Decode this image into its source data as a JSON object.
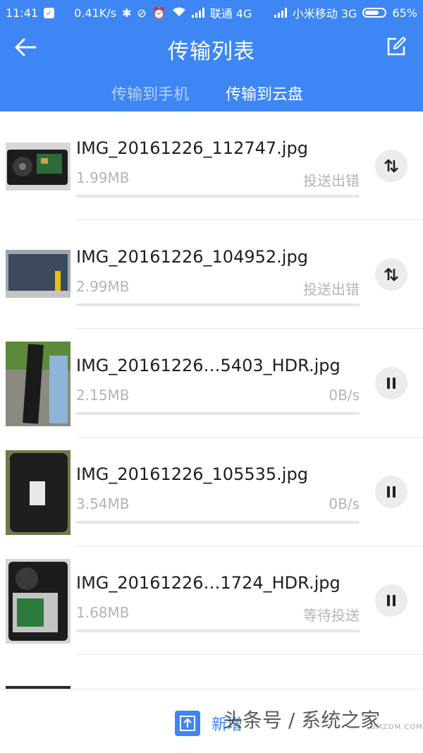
{
  "status_bar": {
    "time": "11:41",
    "net_speed": "0.41K/s",
    "carrier1": "联通 4G",
    "carrier2": "小米移动 3G",
    "battery": "65%"
  },
  "header": {
    "title": "传输列表",
    "tabs": [
      {
        "label": "传输到手机",
        "active": false
      },
      {
        "label": "传输到云盘",
        "active": true
      }
    ]
  },
  "transfers": [
    {
      "name": "IMG_20161226_112747.jpg",
      "size": "1.99MB",
      "status": "投送出错",
      "action": "retry-icon",
      "progress": 0
    },
    {
      "name": "IMG_20161226_104952.jpg",
      "size": "2.99MB",
      "status": "投送出错",
      "action": "retry-icon",
      "progress": 0
    },
    {
      "name": "IMG_20161226…5403_HDR.jpg",
      "size": "2.15MB",
      "status": "0B/s",
      "action": "pause-icon",
      "progress": 0
    },
    {
      "name": "IMG_20161226_105535.jpg",
      "size": "3.54MB",
      "status": "0B/s",
      "action": "pause-icon",
      "progress": 0
    },
    {
      "name": "IMG_20161226…1724_HDR.jpg",
      "size": "1.68MB",
      "status": "等待投送",
      "action": "pause-icon",
      "progress": 0
    }
  ],
  "bottom": {
    "add_label": "新增",
    "watermark": "头条号 / 系统之家",
    "watermark_small": "SMZDM.COM"
  },
  "colors": {
    "accent": "#3d86f3",
    "muted": "#b4b4b4"
  }
}
